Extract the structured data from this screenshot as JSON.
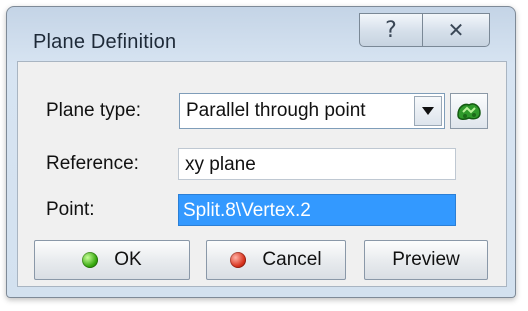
{
  "window": {
    "title": "Plane Definition"
  },
  "titlebar_buttons": {
    "help_glyph": "?",
    "close_glyph": "✕"
  },
  "form": {
    "plane_type": {
      "label": "Plane type:",
      "value": "Parallel through point"
    },
    "reference": {
      "label": "Reference:",
      "value": "xy plane"
    },
    "point": {
      "label": "Point:",
      "value": "Split.8\\Vertex.2"
    }
  },
  "buttons": {
    "ok": "OK",
    "cancel": "Cancel",
    "preview": "Preview"
  },
  "colors": {
    "selection": "#3399ff",
    "ok_dot": "#36a80e",
    "cancel_dot": "#d8321d"
  },
  "icons": {
    "pick": "law-editor-icon"
  }
}
